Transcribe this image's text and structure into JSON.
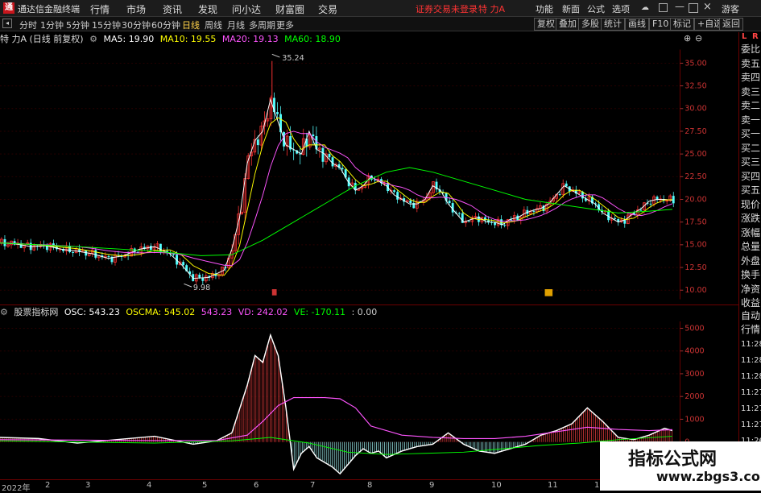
{
  "app": {
    "title": "通达信金融终端",
    "logo_letter": "通"
  },
  "menu": {
    "items": [
      "行情",
      "市场",
      "资讯",
      "发现",
      "问小达",
      "财富圈",
      "交易"
    ],
    "status": "证券交易未登录",
    "stock": "特 力A",
    "right_items": [
      "功能",
      "新面",
      "公式",
      "选项"
    ],
    "guest": "游客"
  },
  "periods": {
    "items": [
      "分时",
      "1分钟",
      "5分钟",
      "15分钟",
      "30分钟",
      "60分钟",
      "日线",
      "周线",
      "月线",
      "多周期",
      "更多"
    ],
    "active": "日线"
  },
  "toolbar": {
    "items": [
      "复权",
      "叠加",
      "多股",
      "统计",
      "画线",
      "F10",
      "标记",
      "+自选",
      "返回"
    ]
  },
  "legend": {
    "name": "特 力A (日线 前复权)",
    "ma5": "MA5: 19.90",
    "ma10": "MA10: 19.55",
    "ma20": "MA20: 19.13",
    "ma60": "MA60: 18.90"
  },
  "price_chart": {
    "high_label": "35.24",
    "low_label": "9.98",
    "y_ticks": [
      "35.00",
      "32.50",
      "30.00",
      "27.50",
      "25.00",
      "22.50",
      "20.00",
      "17.50",
      "15.00",
      "12.50",
      "10.00"
    ],
    "y_min": 9.0,
    "y_max": 36.5
  },
  "osc_legend": {
    "name": "股票指标网",
    "osc": "OSC: 543.23",
    "oscma": "OSCMA: 545.02",
    "v1": "543.23",
    "vd": "VD: 242.02",
    "ve": "VE: -170.11",
    "tail": ": 0.00"
  },
  "osc_chart": {
    "y_ticks": [
      "5000",
      "4000",
      "3000",
      "2000",
      "1000",
      "0"
    ],
    "y_min": -1500,
    "y_max": 5300
  },
  "right_panel": {
    "top": [
      "L",
      "R"
    ],
    "labels": [
      "委比",
      "卖五",
      "卖四",
      "卖三",
      "卖二",
      "卖一",
      "买一",
      "买二",
      "买三",
      "买四",
      "买五",
      "现价",
      "涨跌",
      "涨幅",
      "总量",
      "外盘",
      "换手",
      "净资",
      "收益"
    ],
    "lower": [
      "自动",
      "行情"
    ],
    "times": [
      "11:28",
      "11:28",
      "11:28",
      "11:27",
      "11:27",
      "11:27",
      "11:26",
      "11:26",
      "11:26"
    ]
  },
  "dates": [
    "2022年",
    "2",
    "3",
    "4",
    "5",
    "6",
    "7",
    "8",
    "9",
    "10",
    "11",
    "12"
  ],
  "watermark": {
    "line1": "指标公式网",
    "line2": "www.zbgs3.com"
  },
  "colors": {
    "up": "#ff3333",
    "down": "#54ffff",
    "ma5": "#ffffff",
    "ma10": "#ffff00",
    "ma20": "#ff55ff",
    "ma60": "#00ff00"
  },
  "chart_data": {
    "type": "line",
    "series": [
      {
        "name": "MA5",
        "color": "#ffffff",
        "x": [
          0,
          20,
          40,
          60,
          80,
          100,
          120,
          140,
          160,
          180,
          200,
          220,
          235,
          250,
          270,
          290,
          300,
          310,
          320,
          330,
          340,
          350,
          360,
          370,
          380,
          390,
          400,
          410,
          420,
          430,
          440,
          450,
          460,
          470,
          480,
          490,
          500,
          510,
          520,
          530,
          540,
          550,
          560,
          570,
          580,
          590,
          600,
          610,
          620,
          630,
          640,
          650,
          660,
          670,
          680,
          690,
          700,
          710,
          720,
          730,
          740,
          750,
          760,
          770,
          780,
          790,
          800,
          810,
          820,
          830,
          840,
          850,
          860,
          870
        ],
        "y": [
          15.2,
          15.1,
          14.8,
          14.9,
          14.5,
          14.3,
          14.0,
          13.5,
          13.8,
          14.5,
          14.8,
          14.0,
          12.8,
          11.3,
          11.4,
          12.2,
          14.5,
          18.0,
          24.0,
          26.5,
          27.5,
          31.0,
          28.5,
          26.0,
          25.5,
          25.0,
          27.5,
          25.5,
          25.0,
          24.0,
          23.5,
          22.0,
          21.0,
          21.5,
          22.5,
          22.0,
          21.5,
          20.5,
          20.0,
          19.5,
          19.5,
          20.0,
          21.5,
          21.0,
          19.5,
          18.5,
          17.5,
          17.8,
          18.0,
          17.5,
          17.5,
          17.2,
          17.8,
          18.0,
          18.5,
          18.8,
          19.0,
          19.5,
          20.5,
          21.5,
          21.0,
          20.5,
          20.0,
          19.5,
          18.5,
          18.0,
          17.5,
          17.8,
          18.5,
          19.0,
          19.8,
          20.0,
          20.0,
          19.9
        ]
      },
      {
        "name": "MA60",
        "color": "#00ff00",
        "x": [
          0,
          100,
          200,
          260,
          300,
          340,
          380,
          420,
          460,
          500,
          530,
          560,
          600,
          640,
          680,
          720,
          760,
          800,
          840,
          870
        ],
        "y": [
          15.2,
          14.8,
          14.3,
          13.8,
          13.9,
          15.5,
          17.5,
          19.5,
          21.5,
          23.0,
          23.5,
          23.0,
          22.0,
          21.0,
          20.0,
          19.5,
          19.0,
          18.5,
          18.7,
          18.9
        ]
      }
    ],
    "osc_series": [
      {
        "name": "OSC",
        "color": "#ffffff",
        "x": [
          0,
          50,
          100,
          150,
          200,
          250,
          280,
          300,
          320,
          330,
          340,
          350,
          360,
          370,
          380,
          390,
          400,
          410,
          420,
          430,
          440,
          450,
          460,
          470,
          480,
          490,
          500,
          520,
          540,
          560,
          580,
          600,
          620,
          640,
          660,
          680,
          700,
          720,
          740,
          760,
          780,
          800,
          820,
          840,
          860,
          870
        ],
        "y": [
          200,
          150,
          -50,
          100,
          250,
          -100,
          50,
          400,
          2500,
          3800,
          3500,
          4700,
          3800,
          1500,
          -1200,
          -500,
          -200,
          -700,
          -900,
          -1100,
          -1400,
          -1000,
          -600,
          -300,
          -500,
          -400,
          -700,
          -400,
          -200,
          -100,
          400,
          -100,
          -400,
          -500,
          -300,
          -100,
          300,
          500,
          800,
          1500,
          900,
          200,
          100,
          300,
          600,
          500
        ]
      },
      {
        "name": "OSCMA",
        "color": "#ff55ff",
        "x": [
          0,
          100,
          200,
          280,
          320,
          340,
          360,
          380,
          400,
          420,
          440,
          460,
          480,
          520,
          560,
          600,
          640,
          680,
          720,
          760,
          800,
          840,
          870
        ],
        "y": [
          100,
          80,
          60,
          60,
          300,
          900,
          1600,
          1950,
          1950,
          1950,
          1900,
          1500,
          700,
          300,
          200,
          150,
          150,
          250,
          450,
          650,
          550,
          500,
          540
        ]
      },
      {
        "name": "VD",
        "color": "#00ff00",
        "x": [
          0,
          100,
          200,
          300,
          350,
          400,
          450,
          500,
          550,
          600,
          650,
          700,
          750,
          800,
          870
        ],
        "y": [
          50,
          0,
          -50,
          50,
          200,
          -50,
          -450,
          -550,
          -500,
          -450,
          -300,
          -150,
          -50,
          100,
          250
        ]
      }
    ]
  }
}
